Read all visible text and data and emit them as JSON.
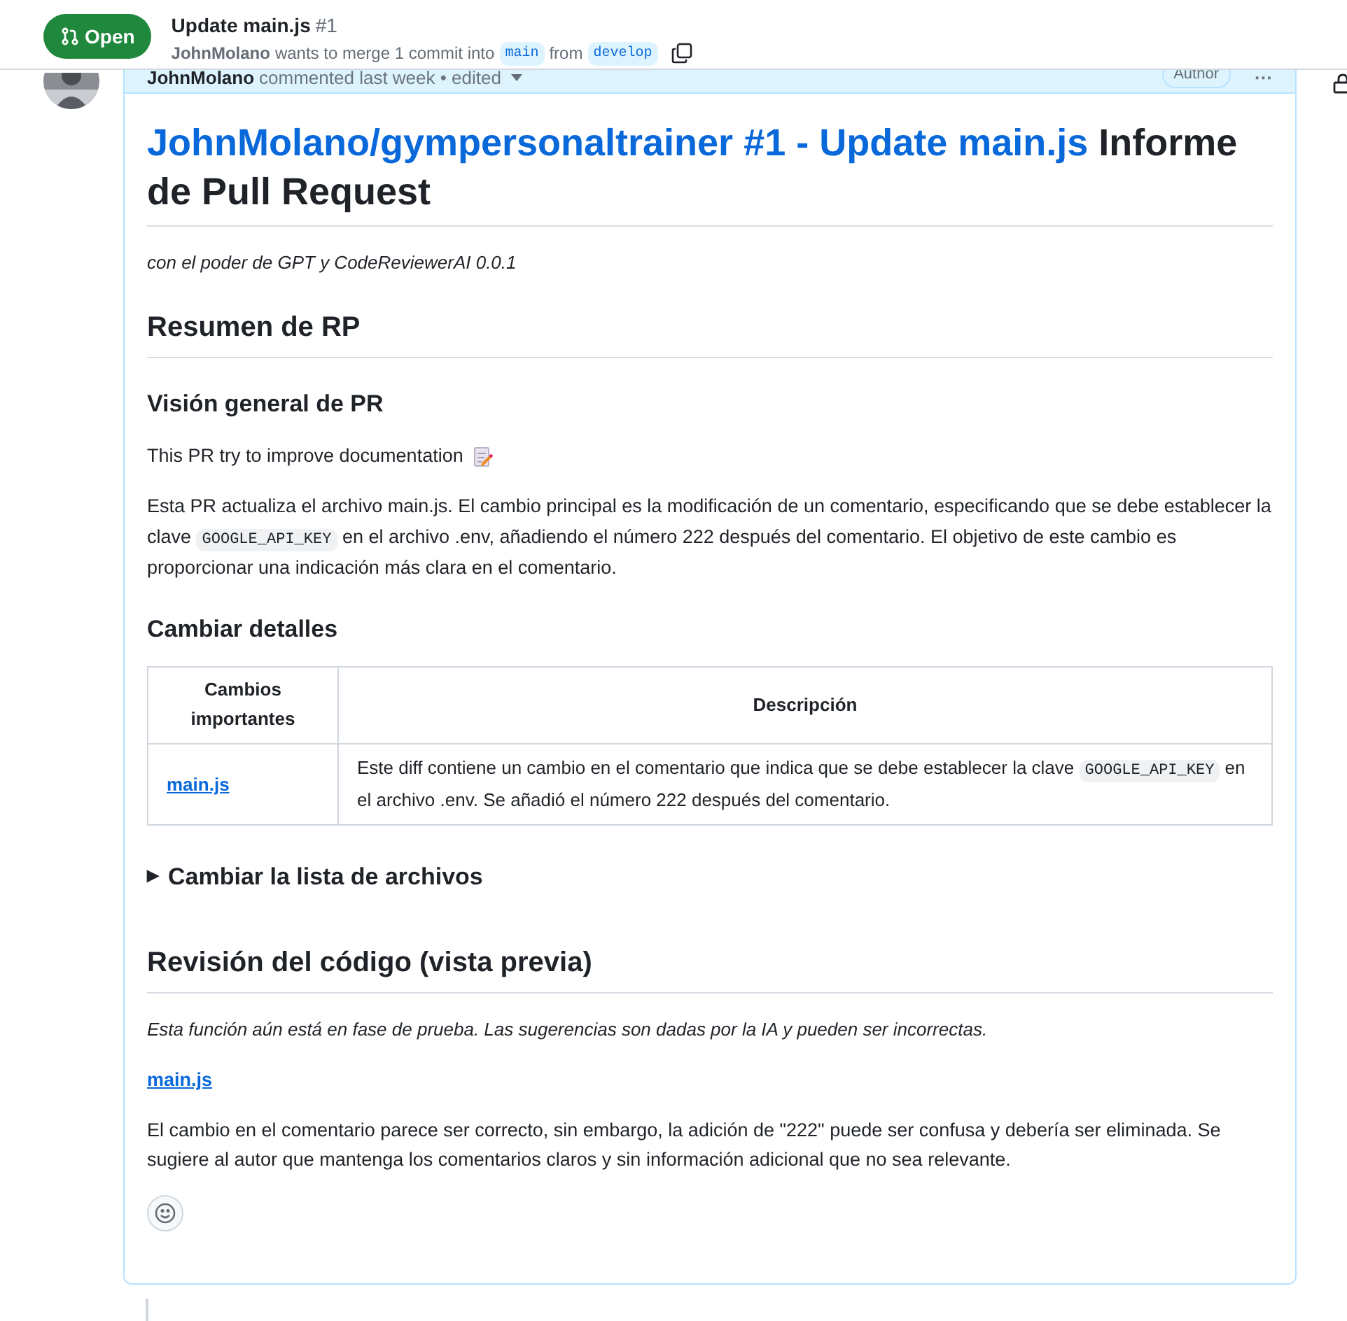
{
  "header": {
    "state": {
      "label": "Open",
      "kind": "open"
    },
    "title": "Update main.js",
    "number": "#1",
    "author": "JohnMolano",
    "merge_text": "wants to merge 1 commit into",
    "base_branch": "main",
    "from_text": "from",
    "head_branch": "develop"
  },
  "comment": {
    "author": "JohnMolano",
    "meta": "commented last week • edited",
    "role": "Author",
    "menu": "···",
    "title_link": "JohnMolano/gympersonaltrainer #1 - Update main.js",
    "title_rest": "Informe de Pull Request",
    "tagline": "con el poder de GPT y CodeReviewerAI 0.0.1",
    "summary_heading": "Resumen de RP",
    "overview_heading": "Visión general de PR",
    "overview_intro": "This PR try to improve documentation",
    "overview_body": [
      {
        "kind": "text",
        "text": "Esta PR actualiza el archivo main.js. El cambio principal es la modificación de un comentario, especificando que se debe establecer la clave "
      },
      {
        "kind": "code",
        "text": "GOOGLE_API_KEY"
      },
      {
        "kind": "text",
        "text": " en el archivo .env, añadiendo el número 222 después del comentario. El objetivo de este cambio es proporcionar una indicación más clara en el comentario."
      }
    ],
    "details_heading": "Cambiar detalles",
    "table": {
      "columns": [
        "Cambios importantes",
        "Descripción"
      ],
      "rows": [
        {
          "file": "main.js",
          "description": [
            {
              "kind": "text",
              "text": "Este diff contiene un cambio en el comentario que indica que se debe establecer la clave "
            },
            {
              "kind": "code",
              "text": "GOOGLE_API_KEY"
            },
            {
              "kind": "text",
              "text": " en el archivo .env. Se añadió el número 222 después del comentario."
            }
          ]
        }
      ]
    },
    "files_summary": {
      "marker": "▶",
      "label": "Cambiar la lista de archivos",
      "expanded": false
    },
    "review_heading": "Revisión del código (vista previa)",
    "review_note": "Esta función aún está en fase de prueba. Las sugerencias son dadas por la IA y pueden ser incorrectas.",
    "review_file": "main.js",
    "review_body": "El cambio en el comentario parece ser correcto, sin embargo, la adición de \"222\" puede ser confusa y debería ser eliminada. Se sugiere al autor que mantenga los comentarios claros y sin información adicional que no sea relevante."
  }
}
